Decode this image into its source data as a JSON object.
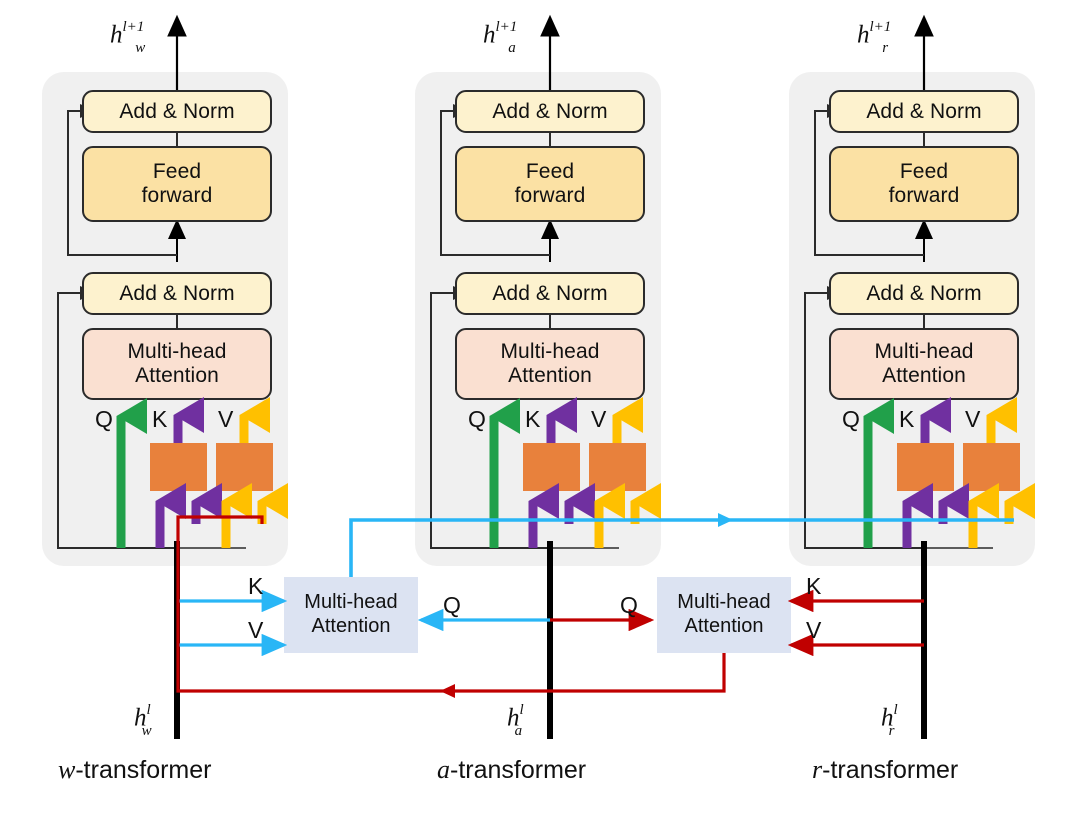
{
  "figure": {
    "type": "architecture-diagram",
    "title": "Three parallel transformer stacks with cross-attention",
    "colors": {
      "panel_bg": "#f0f0f0",
      "add_norm": "#fdf2ce",
      "feed_forward": "#fbe1a4",
      "self_attention": "#fae0d1",
      "cross_attention": "#dce3f2",
      "projection_block": "#e8813c",
      "query_arrow": "#21a04a",
      "key_arrow": "#7030a0",
      "value_arrow": "#ffc000",
      "stream_black": "#000000",
      "link_cyan": "#29b6f6",
      "link_red": "#c00000"
    }
  },
  "columns": [
    {
      "id": "w",
      "name_prefix": "w",
      "name_suffix": "-transformer",
      "output_label": {
        "base": "h",
        "sub": "w",
        "sup": "l+1"
      },
      "input_label": {
        "base": "h",
        "sub": "w",
        "sup": "l"
      },
      "blocks": {
        "add_norm_top": "Add & Norm",
        "feed_forward": "Feed\nforward",
        "add_norm_bottom": "Add & Norm",
        "attention": "Multi-head\nAttention"
      },
      "qkv": [
        "Q",
        "K",
        "V"
      ]
    },
    {
      "id": "a",
      "name_prefix": "a",
      "name_suffix": "-transformer",
      "output_label": {
        "base": "h",
        "sub": "a",
        "sup": "l+1"
      },
      "input_label": {
        "base": "h",
        "sub": "a",
        "sup": "l"
      },
      "blocks": {
        "add_norm_top": "Add & Norm",
        "feed_forward": "Feed\nforward",
        "add_norm_bottom": "Add & Norm",
        "attention": "Multi-head\nAttention"
      },
      "qkv": [
        "Q",
        "K",
        "V"
      ]
    },
    {
      "id": "r",
      "name_prefix": "r",
      "name_suffix": "-transformer",
      "output_label": {
        "base": "h",
        "sub": "r",
        "sup": "l+1"
      },
      "input_label": {
        "base": "h",
        "sub": "r",
        "sup": "l"
      },
      "blocks": {
        "add_norm_top": "Add & Norm",
        "feed_forward": "Feed\nforward",
        "add_norm_bottom": "Add & Norm",
        "attention": "Multi-head\nAttention"
      },
      "qkv": [
        "Q",
        "K",
        "V"
      ]
    }
  ],
  "cross_attention": [
    {
      "id": "left",
      "label": "Multi-head\nAttention",
      "inputs": {
        "k": "K",
        "v": "V",
        "q": "Q"
      }
    },
    {
      "id": "right",
      "label": "Multi-head\nAttention",
      "inputs": {
        "k": "K",
        "v": "V",
        "q": "Q"
      }
    }
  ]
}
